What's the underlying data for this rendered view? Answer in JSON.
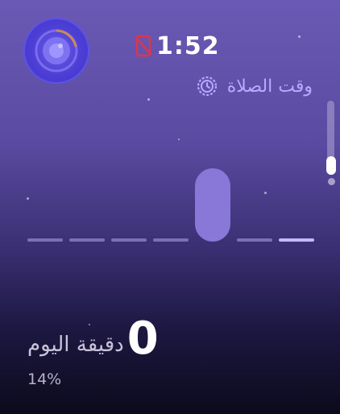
{
  "timer": {
    "text": "1:52",
    "icon": "phone-off-icon",
    "icon_color": "#e0344a"
  },
  "prayer": {
    "label": "وقت الصلاة",
    "icon": "clock-gear-icon",
    "color": "#b9a9ff"
  },
  "avatar": {
    "icon": "progress-ring-icon",
    "accent": "#c98a57"
  },
  "bars": {
    "count": 7,
    "selected_index": 5,
    "highlight_index": 6
  },
  "stats": {
    "value": "0",
    "label": "دقيقة اليوم",
    "percent": "14%"
  }
}
